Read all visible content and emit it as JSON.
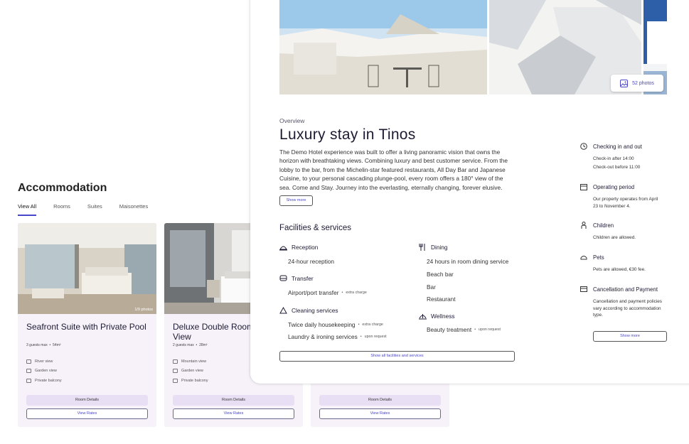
{
  "accommodation": {
    "title": "Accommodation",
    "tabs": [
      "View All",
      "Rooms",
      "Suites",
      "Maisonettes"
    ],
    "rooms": [
      {
        "photo_count": "1/9 photos",
        "name": "Seafront Suite with Private Pool",
        "guests": "3 guests max",
        "size": "54m²",
        "features": [
          "River view",
          "Garden view",
          "Private balcony"
        ],
        "details_label": "Room Details",
        "rates_label": "View Rates"
      },
      {
        "photo_count": "",
        "name": "Deluxe Double Room Mountain View",
        "guests": "2 guests max",
        "size": "28m²",
        "features": [
          "Mountain view",
          "Garden view",
          "Private balcony"
        ],
        "details_label": "Room Details",
        "rates_label": "View Rates"
      },
      {
        "details_label": "Room Details",
        "rates_label": "View Rates"
      }
    ]
  },
  "modal": {
    "photos_label": "52 photos",
    "overview_label": "Overview",
    "title": "Luxury stay in Tinos",
    "description": "The Demo Hotel experience was built to offer a living panoramic vision that owns the horizon with breathtaking views. Combining luxury and best customer service. From the lobby to the bar, from the Michelin-star featured restaurants, All Day Bar and Japanese Cuisine, to your personal cascading plunge-pool, every room offers a 180° view of the sea. Come and Stay. Journey into the everlasting, eternally changing, forever elusive.",
    "show_more": "Show more",
    "facilities_title": "Facilities & services",
    "groups": {
      "reception": "Reception",
      "transfer": "Transfer",
      "cleaning": "Cleaning services",
      "dining": "Dining",
      "wellness": "Wellness"
    },
    "items": {
      "reception_1": "24-hour reception",
      "transfer_1": "Airport/port transfer",
      "transfer_1_note": "extra charge",
      "cleaning_1": "Twice daily housekeeping",
      "cleaning_1_note": "extra charge",
      "cleaning_2": "Laundry & ironing services",
      "cleaning_2_note": "upon request",
      "dining_1": "24 hours in room dining service",
      "dining_2": "Beach bar",
      "dining_3": "Bar",
      "dining_4": "Restaurant",
      "wellness_1": "Beauty treatment",
      "wellness_1_note": "upon request"
    },
    "show_all": "Show all facilities and services",
    "info": {
      "checkin_title": "Checking in and out",
      "checkin_1": "Check-in after 14:00",
      "checkin_2": "Check-out before 11:00",
      "operating_title": "Operating period",
      "operating_text": "Our property operates from April 23 to November 4.",
      "children_title": "Children",
      "children_text": "Children are allowed.",
      "pets_title": "Pets",
      "pets_text": "Pets are allowed, €30 fee.",
      "cancel_title": "Cancellation and Payment",
      "cancel_text": "Cancellation and payment policies vary according to accommodation type.",
      "show_more": "Show more"
    }
  },
  "colors": {
    "accent": "#4a46c9",
    "card_bg": "#f7f2fa",
    "button_fill": "#e8dff5"
  }
}
